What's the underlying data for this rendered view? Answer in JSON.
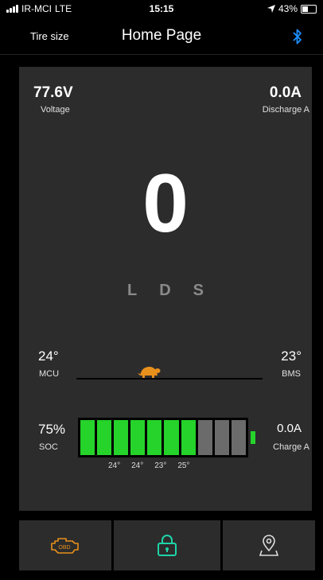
{
  "status_bar": {
    "carrier": "IR-MCI",
    "network": "LTE",
    "time": "15:15",
    "battery": "43%"
  },
  "nav": {
    "left_label": "Tire size",
    "title": "Home Page",
    "icon": "bluetooth-icon"
  },
  "dashboard": {
    "voltage_value": "77.6V",
    "voltage_label": "Voltage",
    "discharge_value": "0.0A",
    "discharge_label": "Discharge A",
    "speed": "0",
    "gears": [
      "L",
      "D",
      "S"
    ],
    "mcu_temp": "24°",
    "mcu_label": "MCU",
    "bms_temp": "23°",
    "bms_label": "BMS",
    "mode_icon": "turtle-icon",
    "soc_value": "75%",
    "soc_label": "SOC",
    "soc_level": 0.75,
    "charge_value": "0.0A",
    "charge_label": "Charge A",
    "cell_temps": [
      "24°",
      "24°",
      "23°",
      "25°"
    ]
  },
  "bottom_bar": {
    "items": [
      {
        "icon": "engine-obd-icon",
        "label": "OBD"
      },
      {
        "icon": "lock-icon"
      },
      {
        "icon": "map-pin-icon"
      }
    ]
  },
  "colors": {
    "accent_green": "#25d32a",
    "accent_teal": "#1fd3a7",
    "accent_orange": "#e8901c",
    "bluetooth_blue": "#1e90ff",
    "panel": "#2c2c2c"
  }
}
